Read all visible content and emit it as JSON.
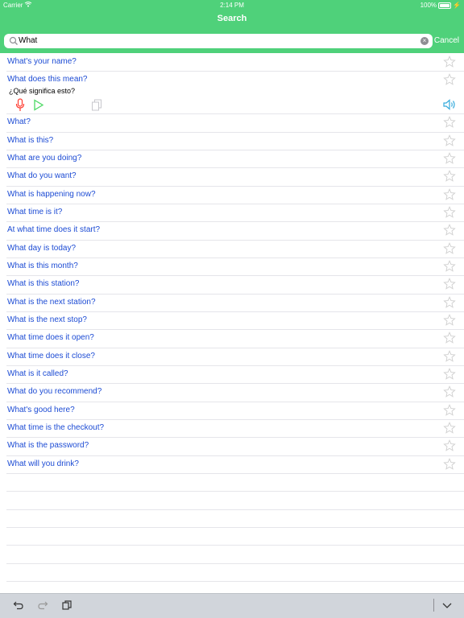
{
  "status": {
    "carrier": "Carrier",
    "time": "2:14 PM",
    "battery": "100%",
    "battery_level": 1.0
  },
  "header": {
    "title": "Search"
  },
  "search": {
    "value": "What",
    "cancel_label": "Cancel"
  },
  "colors": {
    "header": "#4fd17a",
    "link": "#1c4bd4",
    "mic": "#ff3b30",
    "play": "#4cd964",
    "speaker": "#34aadc"
  },
  "expanded_translation": "¿Qué significa esto?",
  "phrases": [
    "What's your name?",
    "What does this mean?",
    "What?",
    "What is this?",
    "What are you doing?",
    "What do you want?",
    "What is happening now?",
    "What time is it?",
    "At what time does it start?",
    "What day is today?",
    "What is this month?",
    "What is this station?",
    "What is the next station?",
    "What is the next stop?",
    "What time does it open?",
    "What time does it close?",
    "What is it called?",
    "What do you recommend?",
    "What's good here?",
    "What time is the checkout?",
    "What is the password?",
    "What will you drink?"
  ],
  "icons": {
    "undo": "undo-icon",
    "redo": "redo-icon",
    "copy": "copy-icon",
    "dismiss": "chevron-down-icon",
    "star": "star-icon",
    "mic": "microphone-icon",
    "play": "play-icon",
    "speaker": "speaker-icon"
  }
}
